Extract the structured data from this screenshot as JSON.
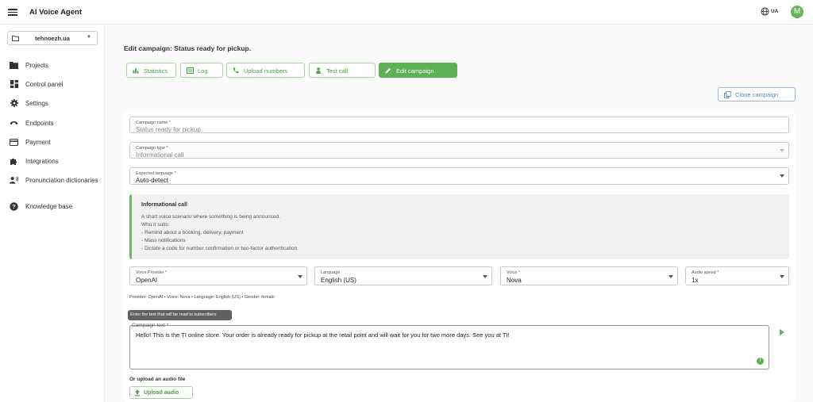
{
  "app": {
    "title": "AI Voice Agent",
    "language": "UA",
    "avatar_letter": "M"
  },
  "sidebar": {
    "project": "tehnoezh.ua",
    "items": [
      {
        "label": "Projects",
        "icon": "folder-icon"
      },
      {
        "label": "Control panel",
        "icon": "dashboard-icon"
      },
      {
        "label": "Settings",
        "icon": "gear-icon"
      },
      {
        "label": "Endpoints",
        "icon": "phone-icon"
      },
      {
        "label": "Payment",
        "icon": "credit-card-icon"
      },
      {
        "label": "Integrations",
        "icon": "puzzle-icon"
      },
      {
        "label": "Pronunciation dictionaries",
        "icon": "speaker-person-icon"
      },
      {
        "label": "Knowledge base",
        "icon": "help-icon"
      }
    ]
  },
  "page": {
    "title": "Edit campaign: Status ready for pickup."
  },
  "tabs": [
    {
      "label": "Statistics",
      "icon": "bar-chart-icon"
    },
    {
      "label": "Log",
      "icon": "list-icon"
    },
    {
      "label": "Upload numbers",
      "icon": "phone-icon"
    },
    {
      "label": "Test call",
      "icon": "person-icon"
    },
    {
      "label": "Edit campaign",
      "icon": "pencil-icon",
      "active": true
    }
  ],
  "clone_label": "Clone campaign",
  "form": {
    "campaign_name": {
      "label": "Campaign name *",
      "value": "Status ready for pickup."
    },
    "campaign_type": {
      "label": "Campaign type *",
      "value": "Informational call"
    },
    "expected_language": {
      "label": "Expected language *",
      "value": "Auto-detect"
    },
    "info": {
      "title": "Informational call",
      "lines": [
        "A short voice scenario where something is being announced.",
        "Who it suits:",
        "- Remind about a booking, delivery, payment",
        "- Mass notifications",
        "- Dictate a code for number confirmation or two-factor authentication"
      ]
    },
    "voice_provider": {
      "label": "Voice Provider *",
      "value": "OpenAI"
    },
    "language": {
      "label": "Language",
      "value": "English (US)"
    },
    "voice": {
      "label": "Voice *",
      "value": "Nova"
    },
    "audio_speed": {
      "label": "Audio speed *",
      "value": "1x"
    },
    "provider_meta": "Provider: OpenAI • Voice: Nova • Language: English (US) • Gender: female",
    "tooltip": "Enter the text that will be read to subscribers",
    "campaign_text_label": "Campaign text *",
    "campaign_text": "Hello! This is the TI online store. Your order is already ready for pickup at the retail point and will wait for you for two more days. See you at TI!",
    "upload_label": "Or upload an audio file",
    "upload_button": "Upload audio"
  },
  "colors": {
    "accent": "#5cb155",
    "link_blue": "#5a86c4"
  }
}
